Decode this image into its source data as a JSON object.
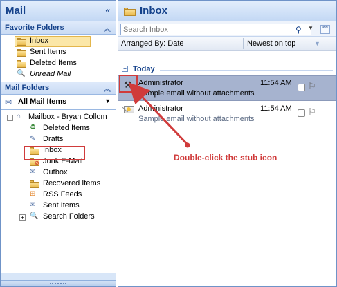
{
  "nav": {
    "title": "Mail",
    "collapse_glyph": "«",
    "favorites": {
      "header": "Favorite Folders",
      "items": [
        {
          "label": "Inbox",
          "icon": "inbox-folder-icon"
        },
        {
          "label": "Sent Items",
          "icon": "folder-icon"
        },
        {
          "label": "Deleted Items",
          "icon": "folder-icon"
        },
        {
          "label": "Unread Mail",
          "icon": "search-folder-icon"
        }
      ]
    },
    "mail_folders": {
      "header": "Mail Folders",
      "view_selector": "All Mail Items",
      "mailbox": "Mailbox - Bryan Collom",
      "folders": [
        {
          "label": "Deleted Items",
          "icon": "recycle-bin-icon"
        },
        {
          "label": "Drafts",
          "icon": "drafts-icon"
        },
        {
          "label": "Inbox",
          "icon": "inbox-folder-icon"
        },
        {
          "label": "Junk E-Mail",
          "icon": "junk-mail-icon"
        },
        {
          "label": "Outbox",
          "icon": "outbox-icon"
        },
        {
          "label": "Recovered Items",
          "icon": "folder-icon"
        },
        {
          "label": "RSS Feeds",
          "icon": "rss-feeds-icon"
        },
        {
          "label": "Sent Items",
          "icon": "sent-items-icon"
        },
        {
          "label": "Search Folders",
          "icon": "search-folders-icon"
        }
      ]
    }
  },
  "inbox": {
    "title": "Inbox",
    "search_placeholder": "Search Inbox",
    "arranged_by": "Arranged By: Date",
    "sort_order": "Newest on top",
    "group_label": "Today",
    "messages": [
      {
        "from": "Administrator",
        "time": "11:54 AM",
        "subject": "Sample email without attachments",
        "icon": "stub-icon",
        "selected": true
      },
      {
        "from": "Administrator",
        "time": "11:54 AM",
        "subject": "Sample email without attachments",
        "icon": "envelope-icon",
        "selected": false
      }
    ]
  },
  "annotation": {
    "text": "Double-click the stub icon",
    "color": "#d03b3b"
  }
}
